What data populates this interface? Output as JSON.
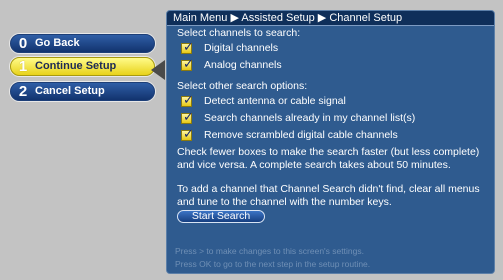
{
  "menu": {
    "items": [
      {
        "number": "0",
        "label": "Go Back",
        "active": false
      },
      {
        "number": "1",
        "label": "Continue Setup",
        "active": true
      },
      {
        "number": "2",
        "label": "Cancel Setup",
        "active": false
      }
    ]
  },
  "breadcrumb": "Main Menu ▶ Assisted Setup ▶ Channel Setup",
  "section1": {
    "heading": "Select channels to search:",
    "options": [
      {
        "label": "Digital channels",
        "checked": true
      },
      {
        "label": "Analog channels",
        "checked": true
      }
    ]
  },
  "section2": {
    "heading": "Select other search options:",
    "options": [
      {
        "label": "Detect antenna or cable signal",
        "checked": true
      },
      {
        "label": "Search channels already in my channel list(s)",
        "checked": true
      },
      {
        "label": "Remove scrambled digital cable channels",
        "checked": true
      }
    ]
  },
  "info_text": "Check fewer boxes to make the search faster (but less complete) and vice versa. A complete search takes about 50 minutes.",
  "add_channel_text": "To add a channel that Channel Search didn't find, clear all menus and tune to the channel with the number keys.",
  "start_button_label": "Start Search",
  "hints": [
    "Press > to make changes to this screen's settings.",
    "Press OK to go to the next step in the setup routine."
  ],
  "checkmark": "✓",
  "colors": {
    "background": "#c3c3c3",
    "panel": "#2f5b8f",
    "breadcrumb_bar": "#0f2f5a",
    "active_item": "#f2e23c",
    "button_blue": "#1f4c8f"
  }
}
